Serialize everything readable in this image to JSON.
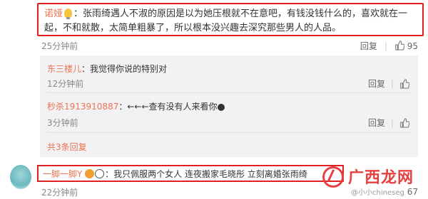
{
  "main_comment": {
    "username": "诺娅",
    "text": "：张雨绮遇人不淑的原因是以为她压根就不在意吧，有钱没钱什么的，喜欢就在一起，不和就散，太简单粗暴了，所以根本没兴趣去深究那些男人的人品。",
    "time": "25分钟前",
    "reply_label": "回复",
    "like_count": "95"
  },
  "replies": [
    {
      "username": "东三楼儿",
      "text": "：我觉得你说的特别对",
      "time": "12分钟前",
      "reply_label": "回复"
    },
    {
      "username": "秒杀1913910887",
      "text": "：←←←查有没有人来看你",
      "time": "3分钟前",
      "reply_label": "回复"
    }
  ],
  "total_replies": "共3条回复",
  "second_comment": {
    "username": "一脚一脚Y",
    "text": "：我只佩服两个女人 连夜搬家毛晓彤 立刻离婚张雨绮",
    "time": "22分钟前",
    "like_count": "67"
  },
  "watermark": {
    "text": "广西龙网",
    "sub": "@小小chineseg"
  },
  "colors": {
    "username": "#eb7350",
    "highlight_border": "#e02020",
    "reply_bg": "#f2f2f5"
  },
  "icons": {
    "like": "thumb-up-icon",
    "tip": "bulb-icon",
    "emoji": "emoji-icon"
  }
}
